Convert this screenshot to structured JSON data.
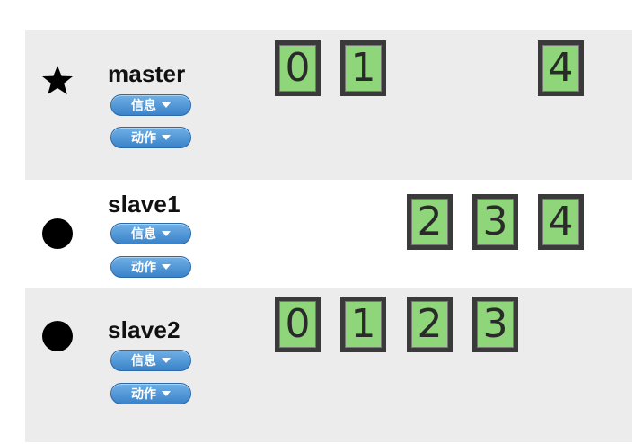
{
  "buttons": {
    "info_label": "信息",
    "action_label": "动作"
  },
  "nodes": [
    {
      "name": "master",
      "role_icon": "star-icon",
      "slots": [
        "0",
        "1",
        "",
        "4"
      ]
    },
    {
      "name": "slave1",
      "role_icon": "circle-icon",
      "slots": [
        "",
        "2",
        "3",
        "4"
      ]
    },
    {
      "name": "slave2",
      "role_icon": "circle-icon",
      "slots": [
        "0",
        "1",
        "2",
        "3"
      ]
    }
  ],
  "colors": {
    "slot_fill": "#8fd67a",
    "slot_border": "#3a3a3a",
    "row_gray": "#ececec",
    "button_blue": "#3a82c9"
  }
}
